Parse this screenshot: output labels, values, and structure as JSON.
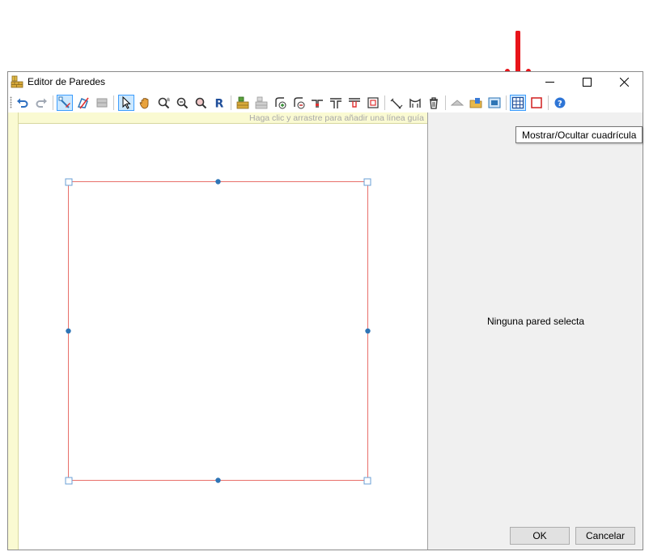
{
  "window": {
    "title": "Editor de Paredes",
    "controls": {
      "minimize": "minimize",
      "maximize": "maximize",
      "close": "close"
    }
  },
  "toolbar": {
    "icons": [
      "undo-icon",
      "redo-icon",
      "wall-draw-icon",
      "wall-polygon-icon",
      "wall-disabled-icon",
      "select-pointer-icon",
      "pan-hand-icon",
      "zoom-in-icon",
      "zoom-window-icon",
      "zoom-fit-icon",
      "reset-R-icon",
      "brick-wall-icon",
      "brick-wall-disabled-icon",
      "add-node-icon",
      "remove-node-icon",
      "split-wall-icon",
      "t-junction-icon",
      "t-junction-inverted-icon",
      "wall-offset-icon",
      "measure-icon",
      "arc-wall-icon",
      "delete-icon",
      "roof-disabled-icon",
      "open-folder-icon",
      "import-image-icon",
      "grid-toggle-icon",
      "square-outline-icon",
      "help-icon"
    ],
    "active": [
      "wall-draw-icon",
      "select-pointer-icon",
      "grid-toggle-icon"
    ]
  },
  "canvas": {
    "ruler_hint": "Haga clic y arrastre para añadir una línea guía",
    "wall_color": "#e8706a",
    "handle_color": "#2e75b6"
  },
  "side_panel": {
    "status": "Ninguna pared selecta",
    "ok_label": "OK",
    "cancel_label": "Cancelar"
  },
  "tooltip": {
    "text": "Mostrar/Ocultar cuadrícula"
  },
  "annotation": {
    "arrow_color": "#e8141a"
  }
}
